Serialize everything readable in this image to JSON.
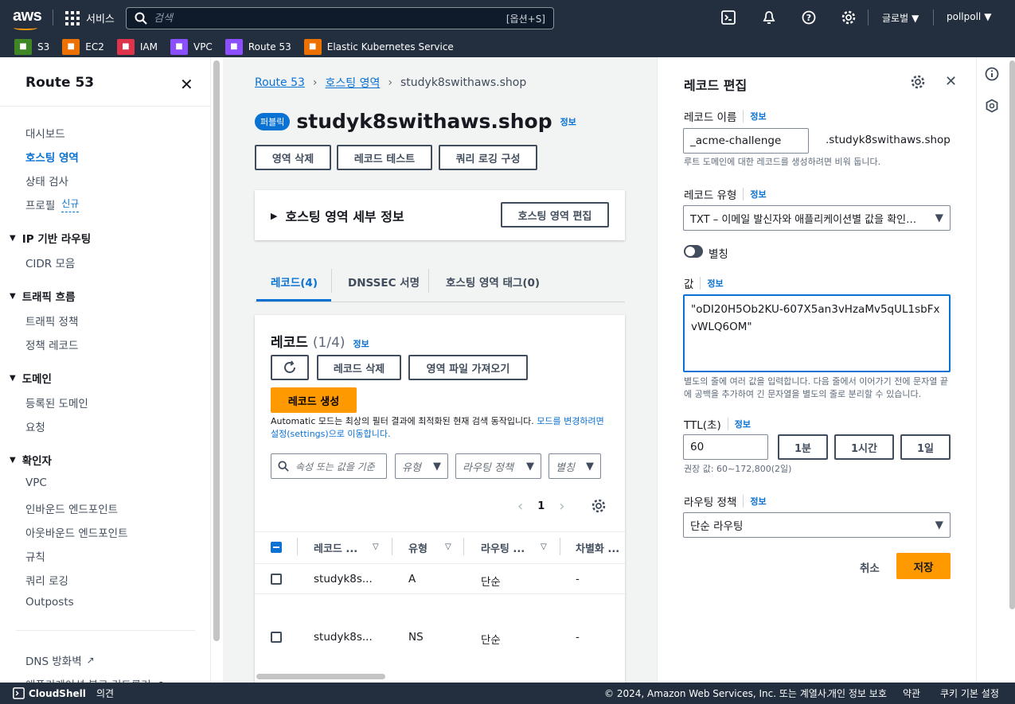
{
  "topnav": {
    "logo": "aws",
    "services_label": "서비스",
    "search_placeholder": "검색",
    "search_shortcut": "[옵션+S]",
    "region": "글로벌",
    "account": "pollpoll"
  },
  "favorites": [
    {
      "label": "S3",
      "color": "#3f8624",
      "icon": "s3-icon"
    },
    {
      "label": "EC2",
      "color": "#ed7100",
      "icon": "ec2-icon"
    },
    {
      "label": "IAM",
      "color": "#dd344c",
      "icon": "iam-icon"
    },
    {
      "label": "VPC",
      "color": "#8c4fff",
      "icon": "vpc-icon"
    },
    {
      "label": "Route 53",
      "color": "#8c4fff",
      "icon": "route53-icon"
    },
    {
      "label": "Elastic Kubernetes Service",
      "color": "#ed7100",
      "icon": "eks-icon"
    }
  ],
  "sidebar": {
    "title": "Route 53",
    "items": {
      "dashboard": "대시보드",
      "hosted_zones": "호스팅 영역",
      "health_checks": "상태 검사",
      "profiles": "프로필",
      "new_badge": "신규",
      "ip_routing": "IP 기반 라우팅",
      "cidr": "CIDR 모음",
      "traffic_flow": "트래픽 흐름",
      "traffic_policies": "트래픽 정책",
      "policy_records": "정책 레코드",
      "domains": "도메인",
      "registered_domains": "등록된 도메인",
      "requests": "요청",
      "resolver": "확인자",
      "vpc": "VPC",
      "inbound": "인바운드 엔드포인트",
      "outbound": "아웃바운드 엔드포인트",
      "rules": "규칙",
      "query_logging": "쿼리 로깅",
      "outposts": "Outposts",
      "dns_firewall": "DNS 방화벽",
      "app_recovery": "애플리케이션 복구 컨트롤러"
    }
  },
  "main": {
    "breadcrumb": [
      "Route 53",
      "호스팅 영역",
      "studyk8swithaws.shop"
    ],
    "badge": "퍼블릭",
    "zone_name": "studyk8swithaws.shop",
    "info": "정보",
    "buttons": {
      "delete_zone": "영역 삭제",
      "test_record": "레코드 테스트",
      "query_log": "쿼리 로깅 구성"
    },
    "details_title": "호스팅 영역 세부 정보",
    "edit_zone": "호스팅 영역 편집",
    "tabs": [
      "레코드(4)",
      "DNSSEC 서명",
      "호스팅 영역 태그(0)"
    ],
    "records_title": "레코드",
    "records_count": "(1/4)",
    "delete_record": "레코드 삭제",
    "import_zone": "영역 파일 가져오기",
    "create_record": "레코드 생성",
    "automatic_note": "Automatic 모드는 최상의 필터 결과에 최적화된 현재 검색 동작입니다.",
    "automatic_link": "모드를 변경하려면 설정(settings)으로 이동합니다.",
    "filter_placeholder": "속성 또는 값을 기준",
    "filter_type": "유형",
    "filter_routing": "라우팅 정책",
    "filter_alias": "별칭",
    "page": "1",
    "columns": [
      "레코드 ...",
      "유형",
      "라우팅 ...",
      "차별화 ..."
    ],
    "rows": [
      {
        "name": "studyk8s...",
        "type": "A",
        "routing": "단순",
        "diff": "-"
      },
      {
        "name": "studyk8s...",
        "type": "NS",
        "routing": "단순",
        "diff": "-"
      }
    ]
  },
  "editor": {
    "title": "레코드 편집",
    "info": "정보",
    "name_label": "레코드 이름",
    "name_value": "_acme-challenge",
    "name_suffix": ".studyk8swithaws.shop",
    "name_hint": "루트 도메인에 대한 레코드를 생성하려면 비워 둡니다.",
    "type_label": "레코드 유형",
    "type_value": "TXT – 이메일 발신자와 애플리케이션별 값을 확인…",
    "alias_label": "별칭",
    "value_label": "값",
    "value_text": "\"oDI20H5Ob2KU-607X5an3vHzaMv5qUL1sbFxvWLQ6OM\"",
    "value_hint": "별도의 줄에 여러 값을 입력합니다. 다음 줄에서 이어가기 전에 문자열 끝에 공백을 추가하여 긴 문자열을 별도의 줄로 분리할 수 있습니다.",
    "ttl_label": "TTL(초)",
    "ttl_value": "60",
    "ttl_1m": "1분",
    "ttl_1h": "1시간",
    "ttl_1d": "1일",
    "ttl_hint": "권장 값: 60~172,800(2일)",
    "routing_label": "라우팅 정책",
    "routing_value": "단순 라우팅",
    "cancel": "취소",
    "save": "저장"
  },
  "footer": {
    "cloudshell": "CloudShell",
    "feedback": "의견",
    "copyright": "© 2024, Amazon Web Services, Inc. 또는 계열사.",
    "privacy": "개인 정보 보호",
    "terms": "약관",
    "cookies": "쿠키 기본 설정"
  },
  "colors": {
    "accent": "#0972d3",
    "primary_button": "#ff9900",
    "topbar": "#232f3e"
  }
}
